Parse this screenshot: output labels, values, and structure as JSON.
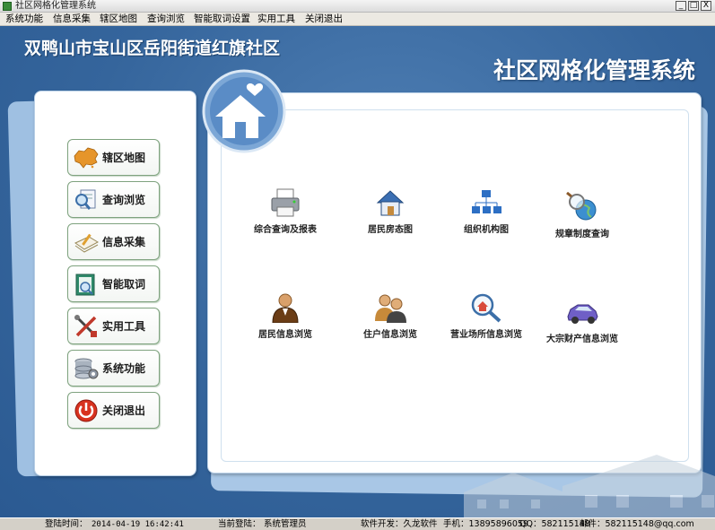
{
  "window": {
    "title": "社区网格化管理系统",
    "minimize": "_",
    "maximize": "□",
    "close": "X"
  },
  "menu": [
    "系统功能",
    "信息采集",
    "辖区地图",
    "查询浏览",
    "智能取词设置",
    "实用工具",
    "关闭退出"
  ],
  "header": {
    "community": "双鸭山市宝山区岳阳街道红旗社区",
    "system_title": "社区网格化管理系统"
  },
  "sidebar": {
    "items": [
      {
        "label": "辖区地图",
        "icon": "china-map-icon"
      },
      {
        "label": "查询浏览",
        "icon": "magnifier-document-icon"
      },
      {
        "label": "信息采集",
        "icon": "pencil-notes-icon"
      },
      {
        "label": "智能取词",
        "icon": "book-magnifier-icon"
      },
      {
        "label": "实用工具",
        "icon": "tools-icon"
      },
      {
        "label": "系统功能",
        "icon": "database-gear-icon"
      },
      {
        "label": "关闭退出",
        "icon": "power-icon"
      }
    ]
  },
  "functions": [
    {
      "label": "综合查询及报表",
      "icon": "printer-icon"
    },
    {
      "label": "居民房态图",
      "icon": "house-icon"
    },
    {
      "label": "组织机构图",
      "icon": "org-chart-icon"
    },
    {
      "label": "规章制度查询",
      "icon": "globe-magnifier-icon"
    },
    {
      "label": "居民信息浏览",
      "icon": "resident-icon"
    },
    {
      "label": "住户信息浏览",
      "icon": "household-icon"
    },
    {
      "label": "营业场所信息浏览",
      "icon": "business-search-icon"
    },
    {
      "label": "大宗财产信息浏览",
      "icon": "car-icon"
    }
  ],
  "status": {
    "login_time_label": "登陆时间：",
    "login_time": "2014-04-19 16:42:41",
    "current_user_label": "当前登陆：",
    "current_user": "系统管理员",
    "developer": "软件开发：久龙软件",
    "phone": "手机：13895896059",
    "qq": "QQ：582115148",
    "email": "邮件：582115148@qq.com"
  },
  "colors": {
    "background_blue": "#35659c",
    "panel_white": "#ffffff",
    "button_border": "#7ea27e"
  }
}
